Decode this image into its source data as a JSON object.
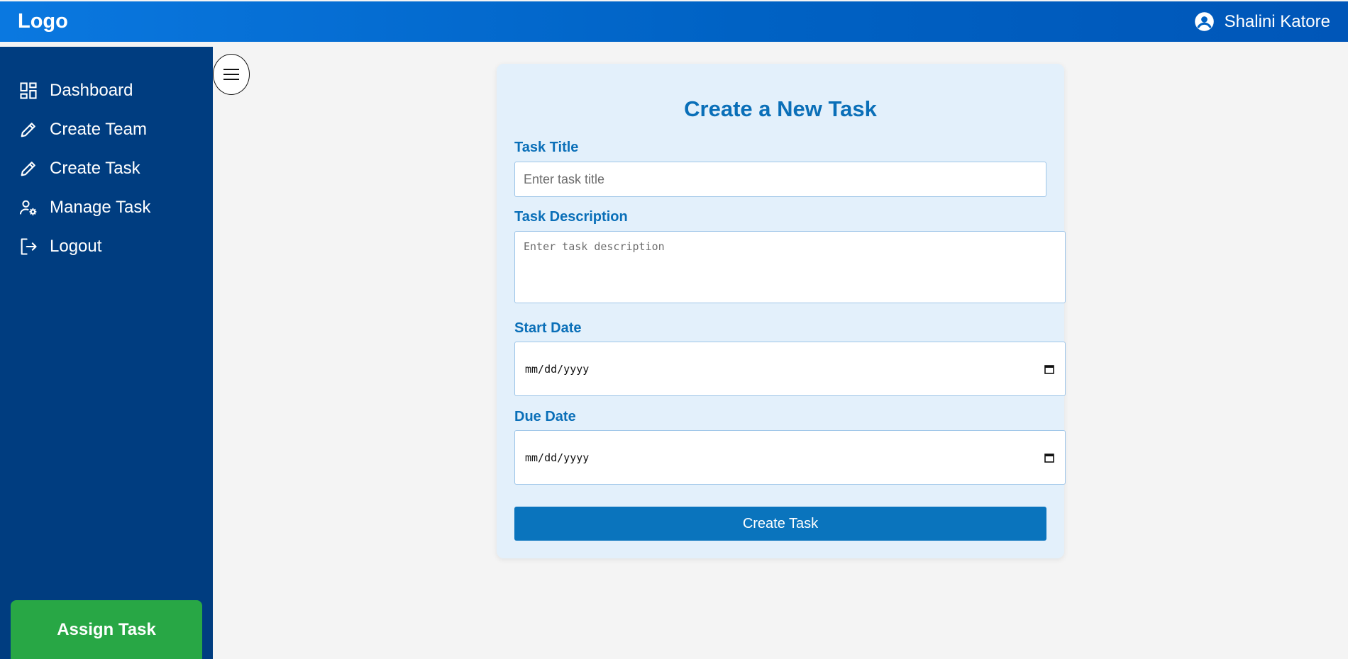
{
  "header": {
    "logo": "Logo",
    "user_name": "Shalini Katore",
    "user_icon": "account-circle-icon"
  },
  "sidebar": {
    "items": [
      {
        "label": "Dashboard",
        "icon": "dashboard-icon"
      },
      {
        "label": "Create Team",
        "icon": "pencil-icon"
      },
      {
        "label": "Create Task",
        "icon": "pencil-icon"
      },
      {
        "label": "Manage Task",
        "icon": "user-gear-icon"
      },
      {
        "label": "Logout",
        "icon": "logout-icon"
      }
    ],
    "assign_button": "Assign Task"
  },
  "toggle": {
    "icon": "hamburger-menu-icon"
  },
  "form": {
    "title": "Create a New Task",
    "task_title_label": "Task Title",
    "task_title_placeholder": "Enter task title",
    "task_title_value": "",
    "description_label": "Task Description",
    "description_placeholder": "Enter task description",
    "description_value": "",
    "start_date_label": "Start Date",
    "start_date_value": "mm/dd/yyyy",
    "due_date_label": "Due Date",
    "due_date_value": "mm/dd/yyyy",
    "submit_label": "Create Task"
  },
  "colors": {
    "header_start": "#0a78e0",
    "header_end": "#0056b8",
    "sidebar": "#003d80",
    "assign_button": "#28a745",
    "card": "#e3f0fb",
    "accent": "#0a6fb8",
    "submit_button": "#0a74bd"
  }
}
